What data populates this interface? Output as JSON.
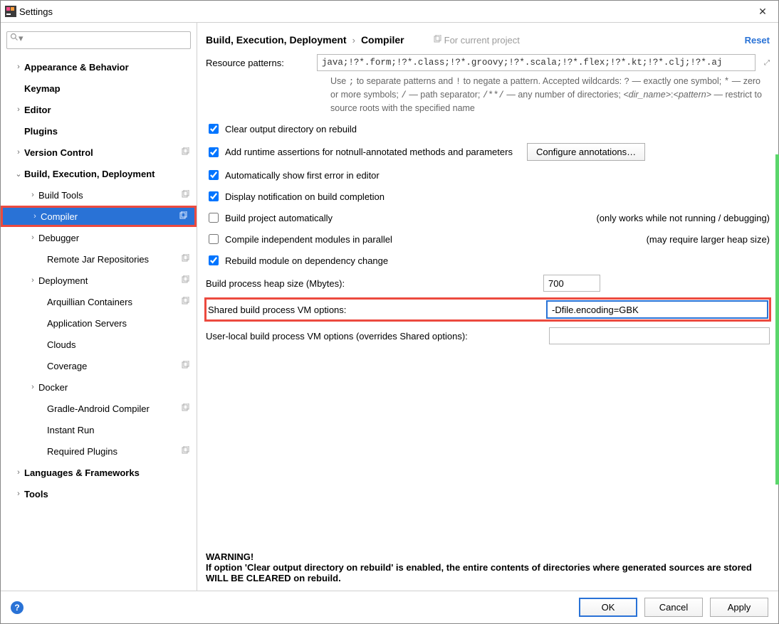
{
  "window": {
    "title": "Settings",
    "close_glyph": "✕"
  },
  "sidebar": {
    "search_placeholder": "",
    "items": [
      {
        "label": "Appearance & Behavior",
        "bold": true,
        "expand": "›",
        "indent": 0,
        "copy": false
      },
      {
        "label": "Keymap",
        "bold": true,
        "expand": "",
        "indent": 0,
        "copy": false
      },
      {
        "label": "Editor",
        "bold": true,
        "expand": "›",
        "indent": 0,
        "copy": false
      },
      {
        "label": "Plugins",
        "bold": true,
        "expand": "",
        "indent": 0,
        "copy": false
      },
      {
        "label": "Version Control",
        "bold": true,
        "expand": "›",
        "indent": 0,
        "copy": true
      },
      {
        "label": "Build, Execution, Deployment",
        "bold": true,
        "expand": "⌄",
        "indent": 0,
        "copy": false
      },
      {
        "label": "Build Tools",
        "bold": false,
        "expand": "›",
        "indent": 1,
        "copy": true
      },
      {
        "label": "Compiler",
        "bold": false,
        "expand": "›",
        "indent": 1,
        "copy": true,
        "selected": true,
        "redbox": true
      },
      {
        "label": "Debugger",
        "bold": false,
        "expand": "›",
        "indent": 1,
        "copy": false
      },
      {
        "label": "Remote Jar Repositories",
        "bold": false,
        "expand": "",
        "indent": 2,
        "copy": true
      },
      {
        "label": "Deployment",
        "bold": false,
        "expand": "›",
        "indent": 1,
        "copy": true
      },
      {
        "label": "Arquillian Containers",
        "bold": false,
        "expand": "",
        "indent": 2,
        "copy": true
      },
      {
        "label": "Application Servers",
        "bold": false,
        "expand": "",
        "indent": 2,
        "copy": false
      },
      {
        "label": "Clouds",
        "bold": false,
        "expand": "",
        "indent": 2,
        "copy": false
      },
      {
        "label": "Coverage",
        "bold": false,
        "expand": "",
        "indent": 2,
        "copy": true
      },
      {
        "label": "Docker",
        "bold": false,
        "expand": "›",
        "indent": 1,
        "copy": false
      },
      {
        "label": "Gradle-Android Compiler",
        "bold": false,
        "expand": "",
        "indent": 2,
        "copy": true
      },
      {
        "label": "Instant Run",
        "bold": false,
        "expand": "",
        "indent": 2,
        "copy": false
      },
      {
        "label": "Required Plugins",
        "bold": false,
        "expand": "",
        "indent": 2,
        "copy": true
      },
      {
        "label": "Languages & Frameworks",
        "bold": true,
        "expand": "›",
        "indent": 0,
        "copy": false
      },
      {
        "label": "Tools",
        "bold": true,
        "expand": "›",
        "indent": 0,
        "copy": false
      }
    ]
  },
  "header": {
    "crumb1": "Build, Execution, Deployment",
    "crumb2": "Compiler",
    "for_project": "For current project",
    "reset": "Reset"
  },
  "main": {
    "resource_patterns_label": "Resource patterns:",
    "resource_patterns_value": "java;!?*.form;!?*.class;!?*.groovy;!?*.scala;!?*.flex;!?*.kt;!?*.clj;!?*.aj",
    "help_line1_a": "Use ",
    "help_line1_b": " to separate patterns and ",
    "help_line1_c": " to negate a pattern. Accepted wildcards: ",
    "help_line1_d": " — exactly one symbol; ",
    "help_line1_e": " — zero or more symbols; ",
    "help_line1_f": " — path separator; ",
    "help_line1_g": " — any number of directories; ",
    "help_line1_h_em": "<dir_name>",
    "help_line1_i": ":",
    "help_line1_j_em": "<pattern>",
    "help_line1_k": " — restrict to source roots with the specified name",
    "sep_semicolon": ";",
    "sep_bang": "!",
    "sep_q": "?",
    "sep_star": "*",
    "sep_slash": "/",
    "sep_dblslash": "/**/",
    "chk1": "Clear output directory on rebuild",
    "chk2": "Add runtime assertions for notnull-annotated methods and parameters",
    "configure_btn": "Configure annotations…",
    "chk3": "Automatically show first error in editor",
    "chk4": "Display notification on build completion",
    "chk5": "Build project automatically",
    "chk5_note": "(only works while not running / debugging)",
    "chk6": "Compile independent modules in parallel",
    "chk6_note": "(may require larger heap size)",
    "chk7": "Rebuild module on dependency change",
    "heap_label": "Build process heap size (Mbytes):",
    "heap_value": "700",
    "shared_vm_label": "Shared build process VM options:",
    "shared_vm_value": "-Dfile.encoding=GBK",
    "local_vm_label": "User-local build process VM options (overrides Shared options):",
    "local_vm_value": "",
    "warning_title": "WARNING!",
    "warning_text": "If option 'Clear output directory on rebuild' is enabled, the entire contents of directories where generated sources are stored WILL BE CLEARED on rebuild."
  },
  "footer": {
    "ok": "OK",
    "cancel": "Cancel",
    "apply": "Apply"
  }
}
